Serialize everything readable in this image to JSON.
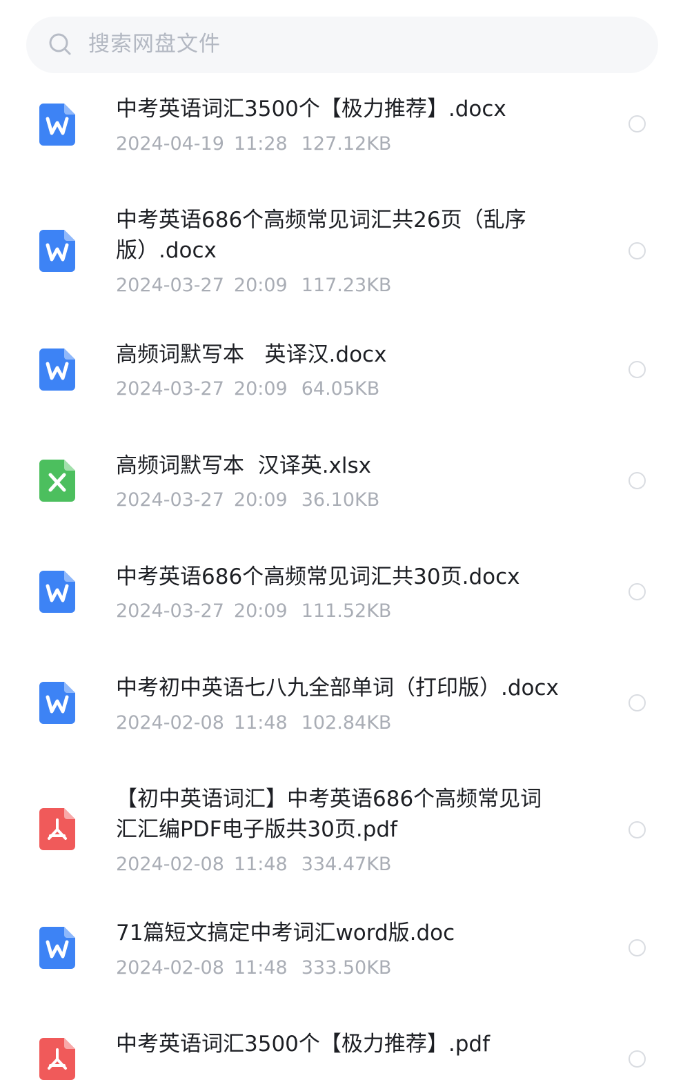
{
  "search": {
    "placeholder": "搜索网盘文件"
  },
  "colors": {
    "word": "#3d83f5",
    "excel": "#4cbf5e",
    "pdf": "#f05a5a",
    "name_text": "#1d1f24",
    "meta_text": "#a9adb5"
  },
  "files": [
    {
      "type": "word",
      "icon": "word-doc-icon",
      "name_lines": [
        "中考英语词汇3500个【极力推荐】.docx"
      ],
      "date": "2024-04-19",
      "time": "11:28",
      "size": "127.12KB"
    },
    {
      "type": "word",
      "icon": "word-doc-icon",
      "name_lines": [
        "中考英语686个高频常见词汇共26页（乱序",
        "版）.docx"
      ],
      "date": "2024-03-27",
      "time": "20:09",
      "size": "117.23KB"
    },
    {
      "type": "word",
      "icon": "word-doc-icon",
      "name_lines": [
        "高频词默写本   英译汉.docx"
      ],
      "date": "2024-03-27",
      "time": "20:09",
      "size": "64.05KB"
    },
    {
      "type": "excel",
      "icon": "excel-sheet-icon",
      "name_lines": [
        "高频词默写本  汉译英.xlsx"
      ],
      "date": "2024-03-27",
      "time": "20:09",
      "size": "36.10KB"
    },
    {
      "type": "word",
      "icon": "word-doc-icon",
      "name_lines": [
        "中考英语686个高频常见词汇共30页.docx"
      ],
      "date": "2024-03-27",
      "time": "20:09",
      "size": "111.52KB"
    },
    {
      "type": "word",
      "icon": "word-doc-icon",
      "name_lines": [
        "中考初中英语七八九全部单词（打印版）.docx"
      ],
      "date": "2024-02-08",
      "time": "11:48",
      "size": "102.84KB"
    },
    {
      "type": "pdf",
      "icon": "pdf-doc-icon",
      "name_lines": [
        "【初中英语词汇】中考英语686个高频常见词",
        "汇汇编PDF电子版共30页.pdf"
      ],
      "date": "2024-02-08",
      "time": "11:48",
      "size": "334.47KB"
    },
    {
      "type": "word",
      "icon": "word-doc-icon",
      "name_lines": [
        "71篇短文搞定中考词汇word版.doc"
      ],
      "date": "2024-02-08",
      "time": "11:48",
      "size": "333.50KB"
    },
    {
      "type": "pdf",
      "icon": "pdf-doc-icon",
      "name_lines": [
        "中考英语词汇3500个【极力推荐】.pdf"
      ],
      "date": "",
      "time": "",
      "size": ""
    }
  ]
}
